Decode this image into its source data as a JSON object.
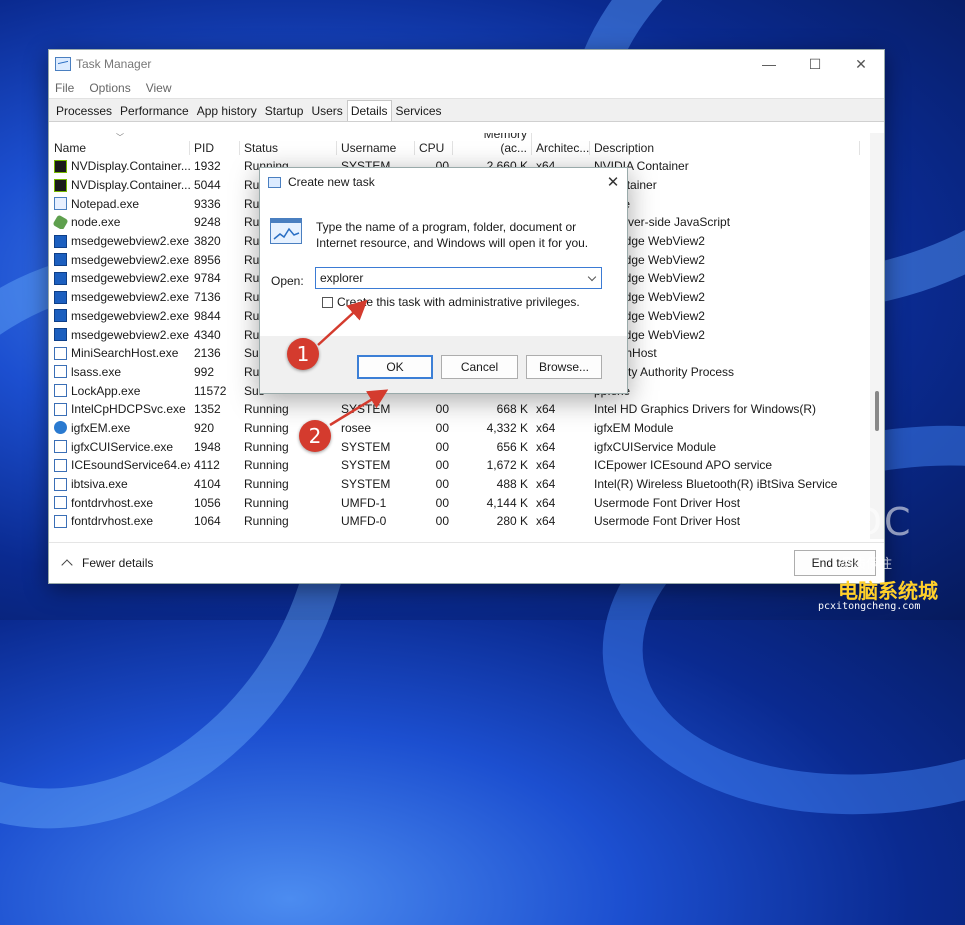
{
  "window": {
    "title": "Task Manager",
    "controls": {
      "minimize": "—",
      "maximize": "☐",
      "close": "✕"
    }
  },
  "menu": [
    "File",
    "Options",
    "View"
  ],
  "tabs": [
    "Processes",
    "Performance",
    "App history",
    "Startup",
    "Users",
    "Details",
    "Services"
  ],
  "active_tab": "Details",
  "columns": [
    "Name",
    "PID",
    "Status",
    "Username",
    "CPU",
    "Memory (ac...",
    "Architec...",
    "Description"
  ],
  "rows": [
    {
      "icon": "nvidia-icon",
      "name": "NVDisplay.Container...",
      "pid": "1932",
      "status": "Running",
      "user": "SYSTEM",
      "cpu": "00",
      "mem": "2,660 K",
      "arch": "x64",
      "desc": "NVIDIA Container"
    },
    {
      "icon": "nvidia-icon",
      "name": "NVDisplay.Container...",
      "pid": "5044",
      "status": "Run",
      "user": "",
      "cpu": "",
      "mem": "",
      "arch": "",
      "desc": "A Container"
    },
    {
      "icon": "notepad-icon",
      "name": "Notepad.exe",
      "pid": "9336",
      "status": "Run",
      "user": "",
      "cpu": "",
      "mem": "",
      "arch": "",
      "desc": "ad.exe"
    },
    {
      "icon": "node-icon",
      "name": "node.exe",
      "pid": "9248",
      "status": "Run",
      "user": "",
      "cpu": "",
      "mem": "",
      "arch": "",
      "desc": "js: Server-side JavaScript"
    },
    {
      "icon": "edge-icon",
      "name": "msedgewebview2.exe",
      "pid": "3820",
      "status": "Run",
      "user": "",
      "cpu": "",
      "mem": "",
      "arch": "",
      "desc": "soft Edge WebView2"
    },
    {
      "icon": "edge-icon",
      "name": "msedgewebview2.exe",
      "pid": "8956",
      "status": "Run",
      "user": "",
      "cpu": "",
      "mem": "",
      "arch": "",
      "desc": "soft Edge WebView2"
    },
    {
      "icon": "edge-icon",
      "name": "msedgewebview2.exe",
      "pid": "9784",
      "status": "Run",
      "user": "",
      "cpu": "",
      "mem": "",
      "arch": "",
      "desc": "soft Edge WebView2"
    },
    {
      "icon": "edge-icon",
      "name": "msedgewebview2.exe",
      "pid": "7136",
      "status": "Run",
      "user": "",
      "cpu": "",
      "mem": "",
      "arch": "",
      "desc": "soft Edge WebView2"
    },
    {
      "icon": "edge-icon",
      "name": "msedgewebview2.exe",
      "pid": "9844",
      "status": "Run",
      "user": "",
      "cpu": "",
      "mem": "",
      "arch": "",
      "desc": "soft Edge WebView2"
    },
    {
      "icon": "edge-icon",
      "name": "msedgewebview2.exe",
      "pid": "4340",
      "status": "Run",
      "user": "",
      "cpu": "",
      "mem": "",
      "arch": "",
      "desc": "soft Edge WebView2"
    },
    {
      "icon": "window-icon",
      "name": "MiniSearchHost.exe",
      "pid": "2136",
      "status": "Sus",
      "user": "",
      "cpu": "",
      "mem": "",
      "arch": "",
      "desc": "SearchHost"
    },
    {
      "icon": "window-icon",
      "name": "lsass.exe",
      "pid": "992",
      "status": "Run",
      "user": "",
      "cpu": "",
      "mem": "",
      "arch": "",
      "desc": "Security Authority Process"
    },
    {
      "icon": "window-icon",
      "name": "LockApp.exe",
      "pid": "11572",
      "status": "Sus",
      "user": "",
      "cpu": "",
      "mem": "",
      "arch": "",
      "desc": "pp.exe"
    },
    {
      "icon": "window-icon",
      "name": "IntelCpHDCPSvc.exe",
      "pid": "1352",
      "status": "Running",
      "user": "SYSTEM",
      "cpu": "00",
      "mem": "668 K",
      "arch": "x64",
      "desc": "Intel HD Graphics Drivers for Windows(R)"
    },
    {
      "icon": "gear-icon",
      "name": "igfxEM.exe",
      "pid": "920",
      "status": "Running",
      "user": "rosee",
      "cpu": "00",
      "mem": "4,332 K",
      "arch": "x64",
      "desc": "igfxEM Module"
    },
    {
      "icon": "window-icon",
      "name": "igfxCUIService.exe",
      "pid": "1948",
      "status": "Running",
      "user": "SYSTEM",
      "cpu": "00",
      "mem": "656 K",
      "arch": "x64",
      "desc": "igfxCUIService Module"
    },
    {
      "icon": "window-icon",
      "name": "ICEsoundService64.exe",
      "pid": "4112",
      "status": "Running",
      "user": "SYSTEM",
      "cpu": "00",
      "mem": "1,672 K",
      "arch": "x64",
      "desc": "ICEpower ICEsound APO service"
    },
    {
      "icon": "window-icon",
      "name": "ibtsiva.exe",
      "pid": "4104",
      "status": "Running",
      "user": "SYSTEM",
      "cpu": "00",
      "mem": "488 K",
      "arch": "x64",
      "desc": "Intel(R) Wireless Bluetooth(R) iBtSiva Service"
    },
    {
      "icon": "window-icon",
      "name": "fontdrvhost.exe",
      "pid": "1056",
      "status": "Running",
      "user": "UMFD-1",
      "cpu": "00",
      "mem": "4,144 K",
      "arch": "x64",
      "desc": "Usermode Font Driver Host"
    },
    {
      "icon": "window-icon",
      "name": "fontdrvhost.exe",
      "pid": "1064",
      "status": "Running",
      "user": "UMFD-0",
      "cpu": "00",
      "mem": "280 K",
      "arch": "x64",
      "desc": "Usermode Font Driver Host"
    }
  ],
  "footer": {
    "fewer_details": "Fewer details",
    "end_task": "End task"
  },
  "dialog": {
    "title": "Create new task",
    "close": "✕",
    "description": "Type the name of a program, folder, document or Internet resource, and Windows will open it for you.",
    "open_label": "Open:",
    "open_value": "explorer",
    "admin_checkbox_label": "Create this task with administrative privileges.",
    "admin_checked": false,
    "ok": "OK",
    "cancel": "Cancel",
    "browse": "Browse..."
  },
  "markers": [
    "1",
    "2"
  ],
  "watermark": {
    "brand": "WIDC",
    "tagline": "品质保住",
    "site_name": "电脑系统城",
    "site_url": "pcxitongcheng.com"
  },
  "colors": {
    "marker": "#d43b2e",
    "accent": "#3c7fd6"
  }
}
